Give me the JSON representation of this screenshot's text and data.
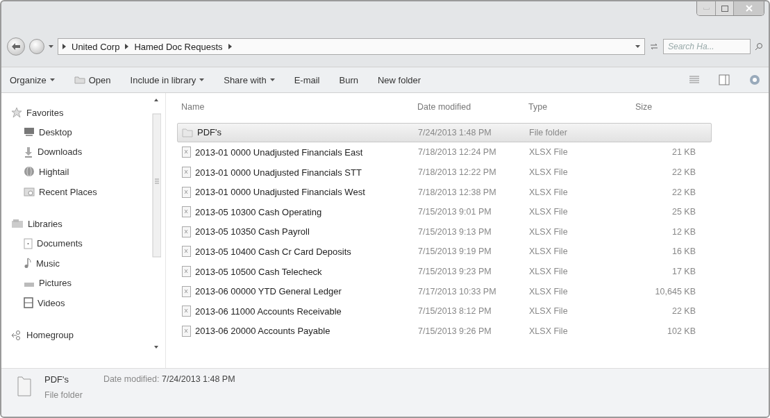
{
  "address": {
    "breadcrumbs": [
      "United Corp",
      "Hamed Doc Requests"
    ],
    "search": {
      "placeholder": "Search Ha..."
    }
  },
  "toolbar": [
    {
      "label": "Organize",
      "dropdown": true,
      "kind": "menu"
    },
    {
      "label": "Open",
      "dropdown": false,
      "kind": "open"
    },
    {
      "label": "Include in library",
      "dropdown": true,
      "kind": "menu"
    },
    {
      "label": "Share with",
      "dropdown": true,
      "kind": "menu"
    },
    {
      "label": "E-mail",
      "dropdown": false,
      "kind": "menu"
    },
    {
      "label": "Burn",
      "dropdown": false,
      "kind": "menu"
    },
    {
      "label": "New folder",
      "dropdown": false,
      "kind": "menu"
    }
  ],
  "sidebar": [
    {
      "label": "Favorites",
      "kind": "favorites",
      "children": [
        {
          "label": "Desktop",
          "kind": "desktop"
        },
        {
          "label": "Downloads",
          "kind": "downloads"
        },
        {
          "label": "Hightail",
          "kind": "globe"
        },
        {
          "label": "Recent Places",
          "kind": "recent"
        }
      ]
    },
    {
      "label": "Libraries",
      "kind": "libraries",
      "children": [
        {
          "label": "Documents",
          "kind": "documents"
        },
        {
          "label": "Music",
          "kind": "music"
        },
        {
          "label": "Pictures",
          "kind": "pictures"
        },
        {
          "label": "Videos",
          "kind": "videos"
        }
      ]
    },
    {
      "label": "Homegroup",
      "kind": "homegroup"
    }
  ],
  "table": {
    "columns": [
      "Name",
      "Date modified",
      "Type",
      "Size"
    ],
    "rows": [
      {
        "kind": "folder",
        "name": "PDF's",
        "date": "7/24/2013 1:48 PM",
        "type": "File folder",
        "selected": true
      },
      {
        "kind": "file",
        "name": "2013-01 0000 Unadjusted Financials East",
        "date": "7/18/2013 12:24 PM",
        "type": "XLSX File",
        "size": "21 KB",
        "selected": false
      },
      {
        "kind": "file",
        "name": "2013-01 0000 Unadjusted Financials STT",
        "date": "7/18/2013 12:22 PM",
        "type": "XLSX File",
        "size": "22 KB",
        "selected": false
      },
      {
        "kind": "file",
        "name": "2013-01 0000 Unadjusted Financials West",
        "date": "7/18/2013 12:38 PM",
        "type": "XLSX File",
        "size": "22 KB",
        "selected": false
      },
      {
        "kind": "file",
        "name": "2013-05 10300 Cash Operating",
        "date": "7/15/2013 9:01 PM",
        "type": "XLSX File",
        "size": "25 KB",
        "selected": false
      },
      {
        "kind": "file",
        "name": "2013-05 10350 Cash Payroll",
        "date": "7/15/2013 9:13 PM",
        "type": "XLSX File",
        "size": "12 KB",
        "selected": false
      },
      {
        "kind": "file",
        "name": "2013-05 10400 Cash Cr Card Deposits",
        "date": "7/15/2013 9:19 PM",
        "type": "XLSX File",
        "size": "16 KB",
        "selected": false
      },
      {
        "kind": "file",
        "name": "2013-05 10500 Cash Telecheck",
        "date": "7/15/2013 9:23 PM",
        "type": "XLSX File",
        "size": "17 KB",
        "selected": false
      },
      {
        "kind": "file",
        "name": "2013-06 00000 YTD General Ledger",
        "date": "7/17/2013 10:33 PM",
        "type": "XLSX File",
        "size": "10,645 KB",
        "selected": false
      },
      {
        "kind": "file",
        "name": "2013-06 11000 Accounts Receivable",
        "date": "7/15/2013 8:12 PM",
        "type": "XLSX File",
        "size": "22 KB",
        "selected": false
      },
      {
        "kind": "file",
        "name": "2013-06 20000 Accounts Payable",
        "date": "7/15/2013 9:26 PM",
        "type": "XLSX File",
        "size": "102 KB",
        "selected": false
      }
    ]
  },
  "details": {
    "name": "PDF's",
    "date_label": "Date modified:",
    "date": "7/24/2013 1:48 PM",
    "type": "File folder"
  }
}
